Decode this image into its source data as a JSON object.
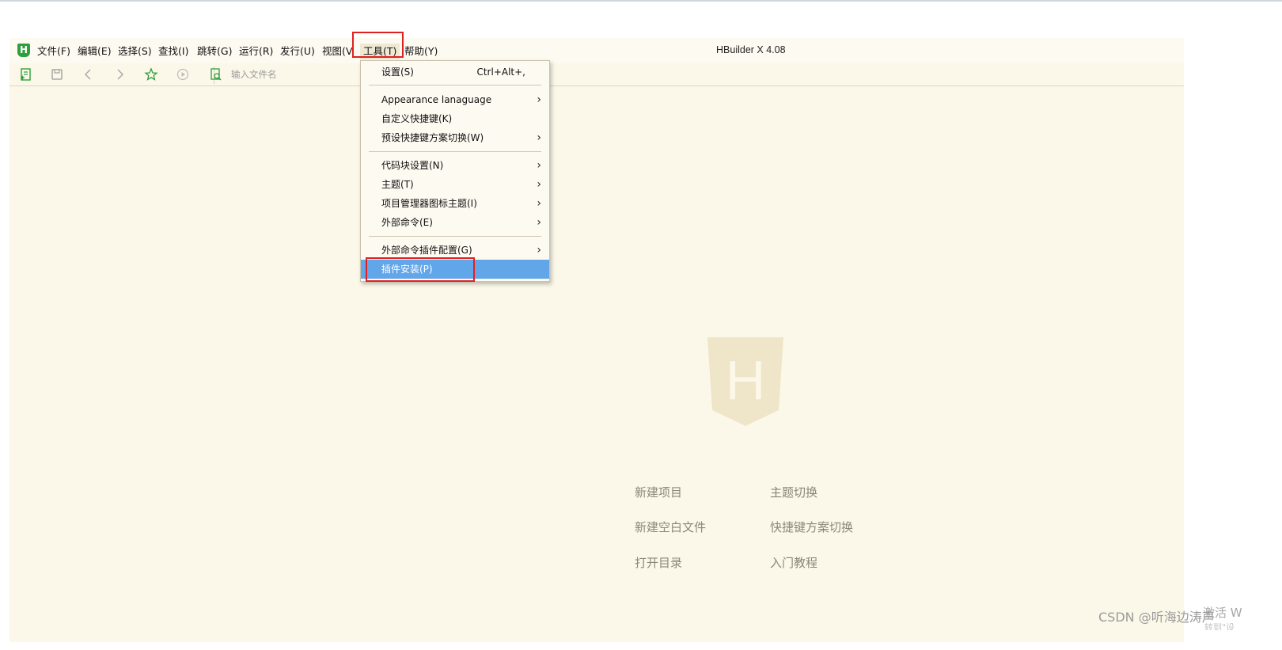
{
  "window": {
    "title": "HBuilder X 4.08",
    "app_logo_letter": "H"
  },
  "menubar": {
    "items": [
      {
        "label": "文件(F)"
      },
      {
        "label": "编辑(E)"
      },
      {
        "label": "选择(S)"
      },
      {
        "label": "查找(I)"
      },
      {
        "label": "跳转(G)"
      },
      {
        "label": "运行(R)"
      },
      {
        "label": "发行(U)"
      },
      {
        "label": "视图(V)"
      },
      {
        "label": "工具(T)",
        "active": true
      },
      {
        "label": "帮助(Y)"
      }
    ]
  },
  "toolbar": {
    "icons": [
      "new-file-icon",
      "save-icon",
      "back-icon",
      "forward-icon",
      "favorite-star-icon",
      "run-icon",
      "search-file-icon"
    ],
    "search_placeholder": "输入文件名"
  },
  "tools_menu": {
    "items": [
      {
        "label": "设置(S)",
        "shortcut": "Ctrl+Alt+,"
      },
      {
        "label": "Appearance lanaguage",
        "submenu": true
      },
      {
        "label": "自定义快捷键(K)"
      },
      {
        "label": "预设快捷键方案切换(W)",
        "submenu": true
      },
      {
        "label": "代码块设置(N)",
        "submenu": true
      },
      {
        "label": "主题(T)",
        "submenu": true
      },
      {
        "label": "项目管理器图标主题(I)",
        "submenu": true
      },
      {
        "label": "外部命令(E)",
        "submenu": true
      },
      {
        "label": "外部命令插件配置(G)",
        "submenu": true
      },
      {
        "label": "插件安装(P)",
        "selected": true
      }
    ],
    "arrow_glyph": "›"
  },
  "welcome": {
    "logo_letter": "H",
    "links": [
      {
        "label": "新建项目"
      },
      {
        "label": "主题切换"
      },
      {
        "label": "新建空白文件"
      },
      {
        "label": "快捷键方案切换"
      },
      {
        "label": "打开目录"
      },
      {
        "label": "入门教程"
      }
    ]
  },
  "overlay": {
    "credit": "CSDN @听海边涛声",
    "activate_line1": "激活 W",
    "activate_line2": "转到\"设"
  },
  "colors": {
    "editor_bg": "#fcf8e9",
    "brand_green": "#2d9f3c",
    "selection_blue": "#62a6ea",
    "highlight_red": "#e02020"
  }
}
